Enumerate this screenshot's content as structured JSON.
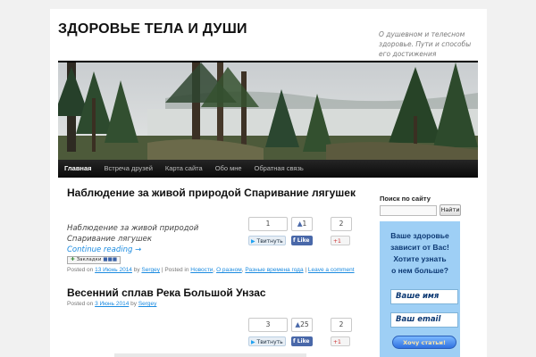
{
  "header": {
    "site_title": "ЗДОРОВЬЕ ТЕЛА И ДУШИ",
    "description": "О душевном и телесном здоровье. Пути и способы его достижения"
  },
  "nav": {
    "items": [
      {
        "label": "Главная",
        "active": true
      },
      {
        "label": "Встреча друзей",
        "active": false
      },
      {
        "label": "Карта сайта",
        "active": false
      },
      {
        "label": "Обо мне",
        "active": false
      },
      {
        "label": "Обратная связь",
        "active": false
      }
    ]
  },
  "posts": [
    {
      "title": "Наблюдение за живой природой Спаривание лягушек",
      "excerpt": "Наблюдение за живой природой  Спаривание лягушек",
      "continue_label": "Continue reading →",
      "bookmarks_label": "Закладки",
      "meta": {
        "posted_on": "Posted on",
        "date": "13 Июнь 2014",
        "by": "by",
        "author": "Sergey",
        "posted_in": "Posted in",
        "categories": [
          "Новости",
          "О разном",
          "Разные времена года"
        ],
        "comment_link": "Leave a comment"
      },
      "share": {
        "tweet_count": "1",
        "tweet_label": "Твитнуть",
        "fb_count": "1",
        "fb_label": "Like",
        "gplus_count": "2",
        "gplus_label": "+1"
      }
    },
    {
      "title": "Весенний сплав Река Большой Унзас",
      "meta": {
        "posted_on": "Posted on",
        "date": "3 Июнь 2014",
        "by": "by",
        "author": "Sergey"
      },
      "share": {
        "tweet_count": "3",
        "tweet_label": "Твитнуть",
        "fb_count": "25",
        "fb_label": "Like",
        "gplus_count": "2",
        "gplus_label": "+1"
      }
    }
  ],
  "sidebar": {
    "search_heading": "Поиск по сайту",
    "search_button": "Найти",
    "promo": {
      "lines": [
        "Ваше здоровье",
        "зависит от Вас!",
        "Хотите узнать",
        "о нем больше?"
      ],
      "name_placeholder": "Ваше имя",
      "email_placeholder": "Ваш email",
      "button": "Хочу статьи!"
    }
  },
  "colors": {
    "link": "#1b8be0",
    "nav_bg": "#111111",
    "promo_bg": "#9ecff5",
    "promo_text": "#0e3a74"
  }
}
